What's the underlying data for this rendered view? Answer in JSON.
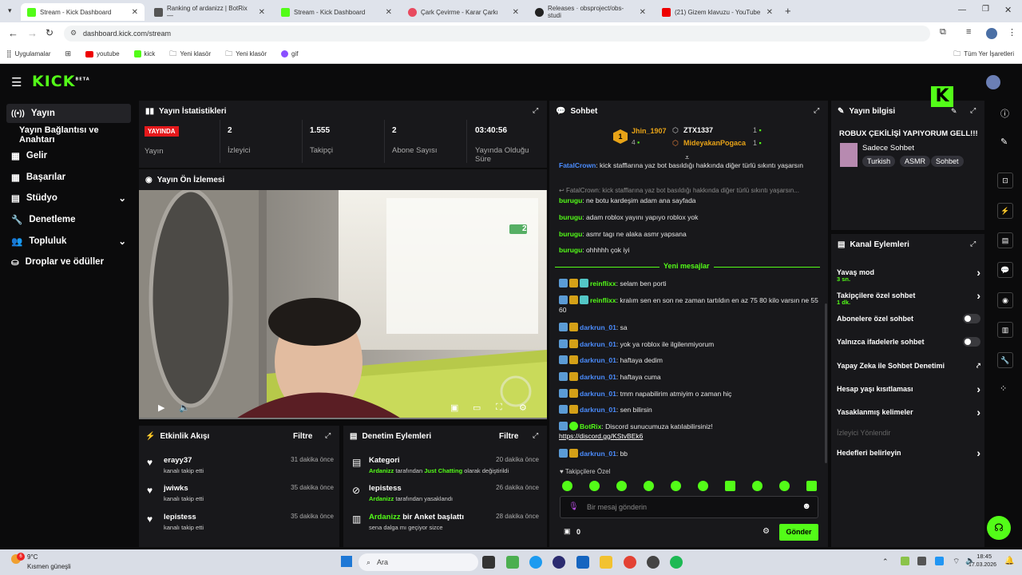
{
  "browser": {
    "tabs": [
      {
        "title": "Stream - Kick Dashboard",
        "color": "#53fc18"
      },
      {
        "title": "Ranking of ardanizz | BotRix —",
        "color": "#555"
      },
      {
        "title": "Stream - Kick Dashboard",
        "color": "#53fc18"
      },
      {
        "title": "Çark Çevirme - Karar Çarkı",
        "color": "#e84a5f"
      },
      {
        "title": "Releases · obsproject/obs-studi",
        "color": "#222"
      },
      {
        "title": "(21) Gizem klavuzu - YouTube",
        "color": "#e00"
      }
    ],
    "url": "dashboard.kick.com/stream",
    "bookmarks": [
      "Uygulamalar",
      "youtube",
      "kick",
      "Yeni klasör",
      "Yeni klasör",
      "gif"
    ],
    "all_bookmarks": "Tüm Yer İşaretleri"
  },
  "logo": "KICK",
  "logo_beta": "BETA",
  "sidebar": {
    "items": [
      {
        "label": "Yayın",
        "icon": "broadcast-icon"
      },
      {
        "label": "Yayın Bağlantısı ve Anahtarı",
        "icon": ""
      },
      {
        "label": "Gelir",
        "icon": "revenue-icon"
      },
      {
        "label": "Başarılar",
        "icon": "achievements-icon"
      },
      {
        "label": "Stüdyo",
        "icon": "studio-icon"
      },
      {
        "label": "Denetleme",
        "icon": "wrench-icon"
      },
      {
        "label": "Topluluk",
        "icon": "community-icon"
      },
      {
        "label": "Droplar ve ödüller",
        "icon": "drops-icon"
      }
    ]
  },
  "stats": {
    "title": "Yayın İstatistikleri",
    "live_badge": "YAYINDA",
    "items": [
      {
        "value": "",
        "label": "Yayın"
      },
      {
        "value": "2",
        "label": "İzleyici"
      },
      {
        "value": "1.555",
        "label": "Takipçi"
      },
      {
        "value": "2",
        "label": "Abone Sayısı"
      },
      {
        "value": "03:40:56",
        "label": "Yayında Olduğu Süre"
      }
    ]
  },
  "preview": {
    "title": "Yayın Ön İzlemesi",
    "viewer_count": "2"
  },
  "activity": {
    "title": "Etkinlik Akışı",
    "filter": "Filtre",
    "items": [
      {
        "name": "erayy37",
        "desc": "kanalı takip etti",
        "time": "31 dakika önce"
      },
      {
        "name": "jwiwks",
        "desc": "kanalı takip etti",
        "time": "35 dakika önce"
      },
      {
        "name": "lepistess",
        "desc": "kanalı takip etti",
        "time": "35 dakika önce"
      }
    ]
  },
  "moderation": {
    "title": "Denetim Eylemleri",
    "filter": "Filtre",
    "items": [
      {
        "name": "Kategori",
        "desc_user": "Ardanizz",
        "desc_mid": "tarafından",
        "desc_hl": "Just Chatting",
        "desc_end": "olarak değiştirildi",
        "time": "20 dakika önce"
      },
      {
        "name": "lepistess",
        "desc_user": "Ardanizz",
        "desc_mid": "tarafından yasaklandı",
        "desc_hl": "",
        "desc_end": "",
        "time": "26 dakika önce"
      },
      {
        "name": "bir Anket başlattı",
        "name_user": "Ardanizz",
        "desc_user": "",
        "desc_mid": "sena dalga mı geçiyor sizce",
        "desc_hl": "",
        "desc_end": "",
        "time": "28 dakika önce"
      }
    ]
  },
  "chat": {
    "title": "Sohbet",
    "leaders": [
      {
        "rank": "1",
        "name": "Jhin_1907",
        "count": "4"
      },
      {
        "rank": "",
        "name": "ZTX1337",
        "count": "1"
      },
      {
        "rank": "",
        "name": "MideyakanPogaca",
        "count": "1"
      }
    ],
    "old": [
      {
        "user": "FatalCrown",
        "text": "kick stafflarına yaz bot basıldığı hakkında diğer türlü sıkıntı yaşarsın"
      },
      {
        "user": "",
        "text": "FatalCrown: kick stafflarına yaz bot basıldığı hakkında diğer türlü sıkıntı yaşarsın..."
      },
      {
        "user": "burugu",
        "text": "ne botu kardeşim adam ana sayfada"
      },
      {
        "user": "burugu",
        "text": "adam roblox yayını yapıyo roblox yok"
      },
      {
        "user": "burugu",
        "text": "asmr tagı ne alaka asmr yapsana"
      },
      {
        "user": "burugu",
        "text": "ohhhhh çok iyi"
      }
    ],
    "new_label": "Yeni mesajlar",
    "messages": [
      {
        "user": "reinflixx",
        "text": "selam ben porti"
      },
      {
        "user": "reinflixx",
        "text": "kralım sen en son ne zaman tartıldın en az 75 80 kilo varsın ne 55 60"
      },
      {
        "user": "darkrun_01",
        "text": "sa"
      },
      {
        "user": "darkrun_01",
        "text": "yok ya roblox ile ilgilenmiyorum"
      },
      {
        "user": "darkrun_01",
        "text": "haftaya dedim"
      },
      {
        "user": "darkrun_01",
        "text": "haftaya cuma"
      },
      {
        "user": "darkrun_01",
        "text": "tmm napabilirim atmiyim o zaman hiç"
      },
      {
        "user": "darkrun_01",
        "text": "sen bilirsin"
      },
      {
        "user": "BotRix",
        "text": "Discord sunucumuza katılabilirsiniz!",
        "link": "https://discord.gg/KStvBEk6"
      },
      {
        "user": "darkrun_01",
        "text": "bb"
      }
    ],
    "followers_only": "Takipçilere Özel",
    "input_placeholder": "Bir mesaj gönderin",
    "points": "0",
    "send": "Gönder"
  },
  "stream_info": {
    "title": "Yayın bilgisi",
    "stream_title": "ROBUX ÇEKİLİŞİ YAPIYORUM GELL!!!",
    "category": "Sadece Sohbet",
    "tags": [
      "Turkish",
      "ASMR",
      "Sohbet"
    ]
  },
  "channel_actions": {
    "title": "Kanal Eylemleri",
    "items": [
      {
        "label": "Yavaş mod",
        "sub": "3 sn.",
        "control": "arrow"
      },
      {
        "label": "Takipçilere özel sohbet",
        "sub": "1 dk.",
        "control": "arrow"
      },
      {
        "label": "Abonelere özel sohbet",
        "sub": "",
        "control": "toggle"
      },
      {
        "label": "Yalnızca ifadelerle sohbet",
        "sub": "",
        "control": "toggle"
      },
      {
        "label": "Yapay Zeka ile Sohbet Denetimi",
        "sub": "",
        "control": "external"
      },
      {
        "label": "Hesap yaşı kısıtlaması",
        "sub": "",
        "control": "arrow"
      },
      {
        "label": "Yasaklanmış kelimeler",
        "sub": "",
        "control": "arrow"
      },
      {
        "label": "İzleyici Yönlendir",
        "sub": "",
        "control": "disabled"
      },
      {
        "label": "Hedefleri belirleyin",
        "sub": "",
        "control": "arrow"
      }
    ]
  },
  "taskbar": {
    "weather_temp": "9°C",
    "weather_desc": "Kısmen güneşli",
    "badge": "6",
    "search": "Ara",
    "time": "18:45",
    "date": "17.03.2026"
  },
  "colors": {
    "accent": "#53fc18",
    "panel": "#18181b",
    "bg": "#0b0b0c",
    "live": "#e5181b",
    "blue_user": "#4b8dff"
  }
}
